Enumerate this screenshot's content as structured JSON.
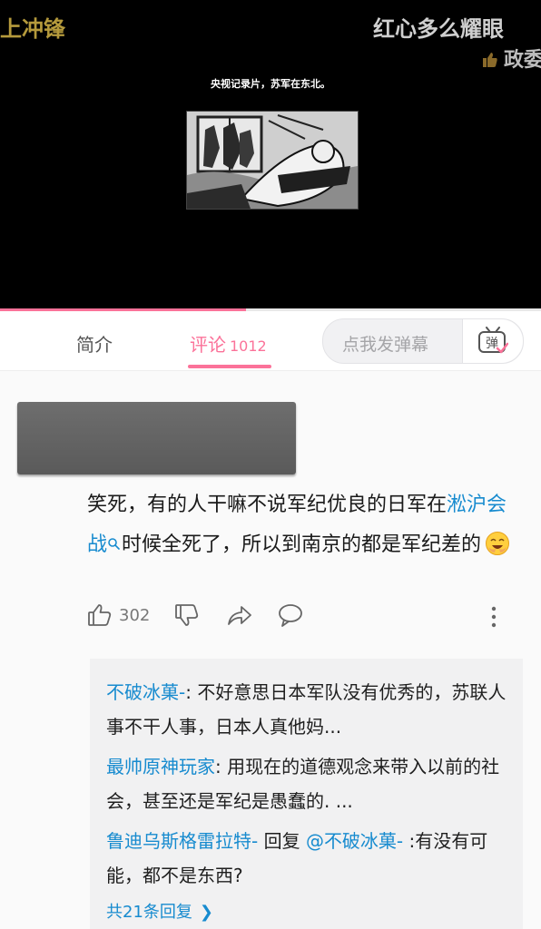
{
  "video": {
    "danmaku": [
      {
        "text": "上冲锋"
      },
      {
        "text": "红心多么耀眼"
      },
      {
        "text": "政委"
      }
    ],
    "caption": "央视记录片，苏军在东北。",
    "progress": 0.455
  },
  "tabs": {
    "intro_label": "简介",
    "comments_label": "评论",
    "comments_count": "1012",
    "danmaku_placeholder": "点我发弹幕",
    "danmaku_icon_char": "弹"
  },
  "comment": {
    "text_before": "笑死，有的人干嘛不说军纪优良的日军在",
    "highlight": "淞沪会战",
    "text_after": "时候全死了，所以到南京的都是军纪差的",
    "like_count": "302"
  },
  "replies": {
    "items": [
      {
        "user": "不破冰菓-",
        "sep": ": ",
        "text": "不好意思日本军队没有优秀的，苏联人事不干人事，日本人真他妈..."
      },
      {
        "user": "最帅原神玩家",
        "sep": ": ",
        "text": "用现在的道德观念来带入以前的社会，甚至还是军纪是愚蠢的. ..."
      },
      {
        "user": "鲁迪乌斯格雷拉特-",
        "reply_word": " 回复 ",
        "mention": "@不破冰菓-",
        "text": " :有没有可能，都不是东西?"
      }
    ],
    "more_label": "共21条回复"
  },
  "colors": {
    "accent": "#fb7299",
    "link": "#178bcf"
  }
}
